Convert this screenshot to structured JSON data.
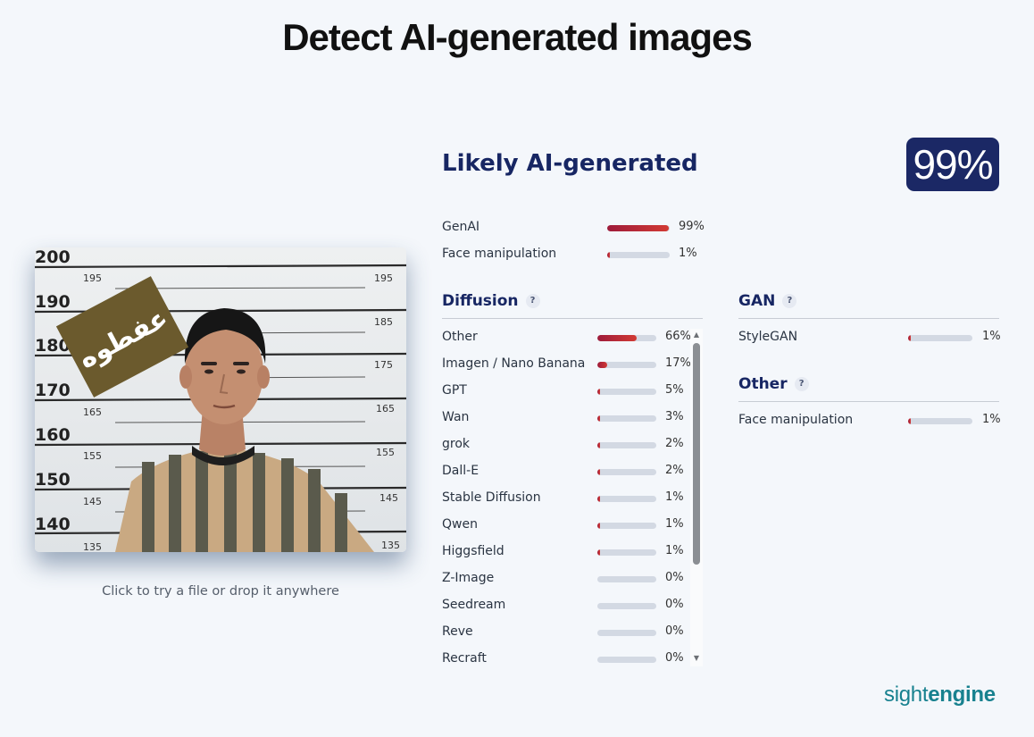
{
  "title": "Detect AI-generated images",
  "upload": {
    "caption": "Click to try a file or drop it anywhere",
    "photo_stamp_text": "عفطوه",
    "height_marks": [
      "200",
      "190",
      "180",
      "170",
      "160",
      "150",
      "140"
    ],
    "inner_marks_left": [
      "195",
      "165",
      "155",
      "145",
      "135"
    ],
    "inner_marks_right": [
      "195",
      "185",
      "175",
      "165",
      "155",
      "145",
      "135"
    ]
  },
  "result": {
    "verdict": "Likely AI-generated",
    "score": "99%"
  },
  "summary": [
    {
      "label": "GenAI",
      "value": 99,
      "display": "99%"
    },
    {
      "label": "Face manipulation",
      "value": 1,
      "display": "1%"
    }
  ],
  "diffusion": {
    "title": "Diffusion",
    "help": "?",
    "items": [
      {
        "label": "Other",
        "value": 66,
        "display": "66%"
      },
      {
        "label": "Imagen / Nano Banana",
        "value": 17,
        "display": "17%"
      },
      {
        "label": "GPT",
        "value": 5,
        "display": "5%"
      },
      {
        "label": "Wan",
        "value": 3,
        "display": "3%"
      },
      {
        "label": "grok",
        "value": 2,
        "display": "2%"
      },
      {
        "label": "Dall-E",
        "value": 2,
        "display": "2%"
      },
      {
        "label": "Stable Diffusion",
        "value": 1,
        "display": "1%"
      },
      {
        "label": "Qwen",
        "value": 1,
        "display": "1%"
      },
      {
        "label": "Higgsfield",
        "value": 1,
        "display": "1%"
      },
      {
        "label": "Z-Image",
        "value": 0,
        "display": "0%"
      },
      {
        "label": "Seedream",
        "value": 0,
        "display": "0%"
      },
      {
        "label": "Reve",
        "value": 0,
        "display": "0%"
      },
      {
        "label": "Recraft",
        "value": 0,
        "display": "0%"
      }
    ]
  },
  "gan": {
    "title": "GAN",
    "help": "?",
    "items": [
      {
        "label": "StyleGAN",
        "value": 1,
        "display": "1%"
      }
    ]
  },
  "other": {
    "title": "Other",
    "help": "?",
    "items": [
      {
        "label": "Face manipulation",
        "value": 1,
        "display": "1%"
      }
    ]
  },
  "brand": {
    "part1": "sight",
    "part2": "engine"
  },
  "colors": {
    "accent": "#172663",
    "badge": "#1b2865",
    "bar_fill": "#c0283a",
    "bar_track": "#d3d9e3",
    "brand": "#18818f"
  }
}
